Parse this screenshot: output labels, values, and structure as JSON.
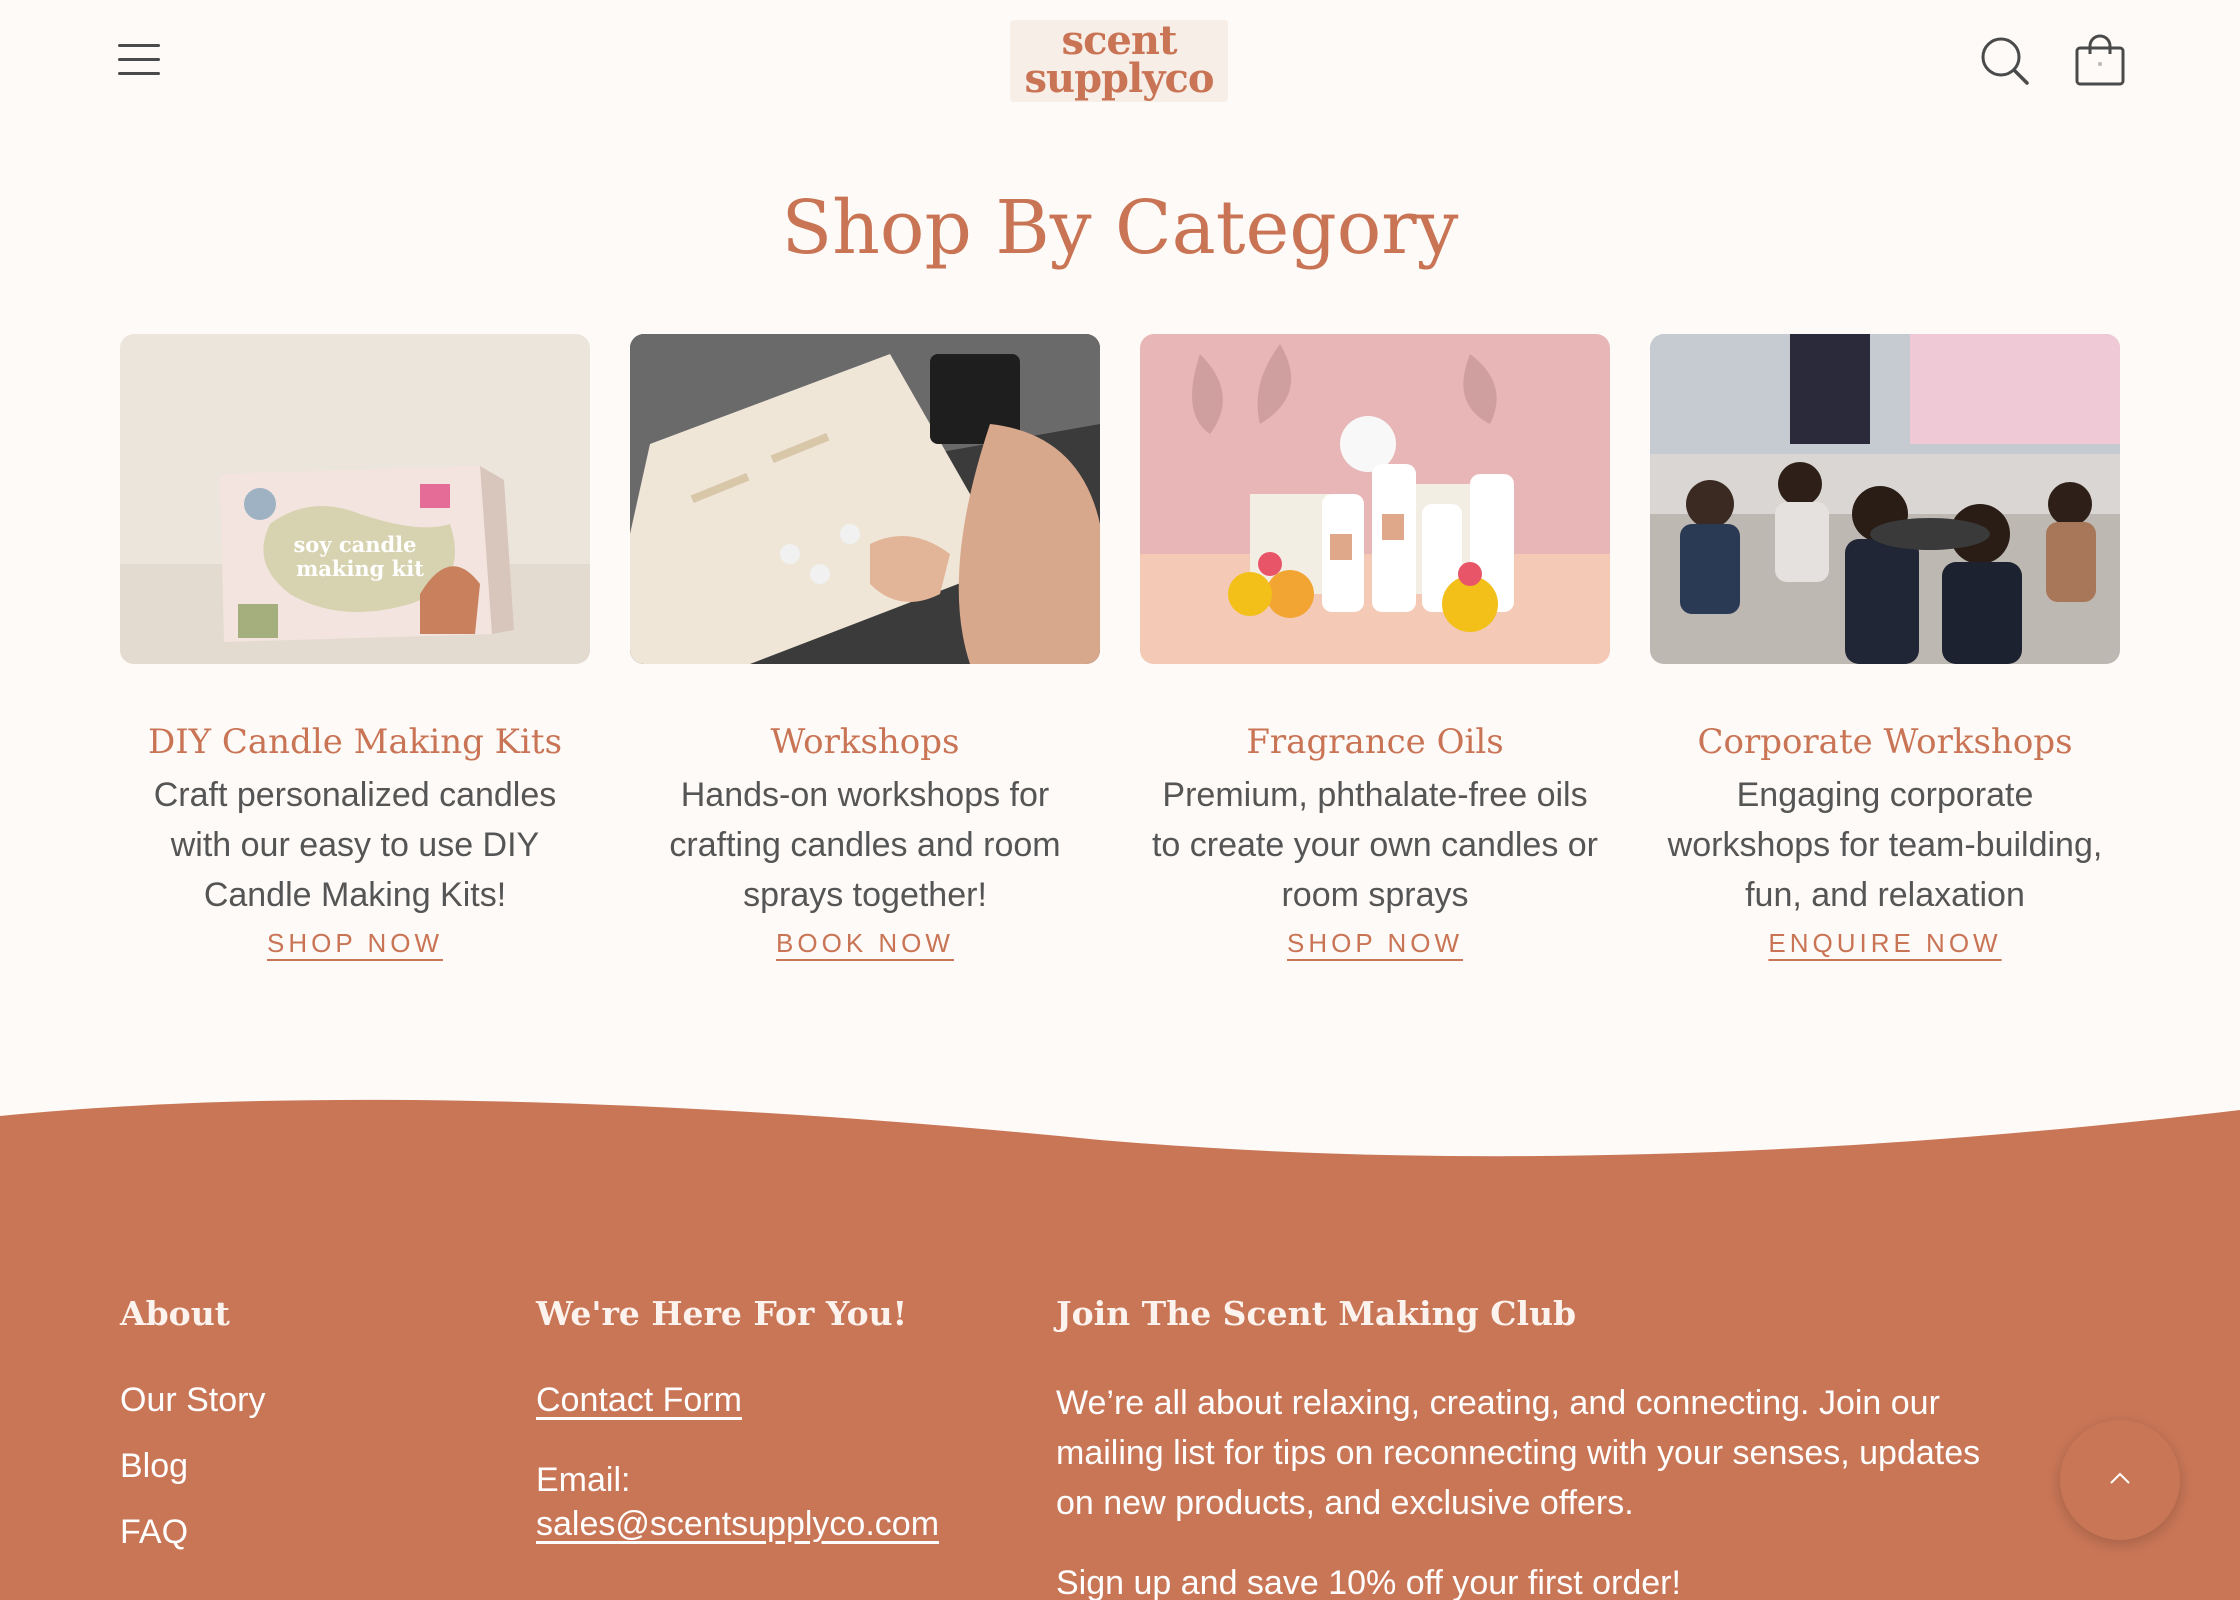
{
  "header": {
    "logo_line1": "scent",
    "logo_line2": "supplyco",
    "menu_icon": "hamburger-menu-icon",
    "search_icon": "search-icon",
    "cart_icon": "shopping-bag-icon"
  },
  "section": {
    "title": "Shop By Category"
  },
  "categories": [
    {
      "title": "DIY Candle Making Kits",
      "description": "Craft personalized candles with our easy to use DIY Candle Making Kits!",
      "cta": "SHOP NOW",
      "image_text_1": "soy candle",
      "image_text_2": "making kit"
    },
    {
      "title": "Workshops",
      "description": "Hands-on workshops for crafting candles and room sprays together!",
      "cta": "BOOK NOW"
    },
    {
      "title": "Fragrance Oils",
      "description": "Premium, phthalate-free oils to create your own candles or room sprays",
      "cta": "SHOP NOW"
    },
    {
      "title": "Corporate Workshops",
      "description": "Engaging corporate workshops for team-building, fun, and relaxation",
      "cta": "ENQUIRE NOW"
    }
  ],
  "footer": {
    "about": {
      "heading": "About",
      "links": [
        "Our Story",
        "Blog",
        "FAQ"
      ]
    },
    "help": {
      "heading": "We're Here For You!",
      "contact_link": "Contact Form",
      "email_label": "Email:",
      "email": "sales@scentsupplyco.com"
    },
    "club": {
      "heading": "Join The Scent Making Club",
      "text": "We’re all about relaxing, creating, and connecting. Join our mailing list for tips on reconnecting with your senses, updates on new products, and exclusive offers.",
      "offer": "Sign up and save 10% off your first order!"
    }
  },
  "back_to_top_icon": "chevron-up-icon",
  "colors": {
    "brand": "#c97455",
    "footer_bg": "#c97657",
    "page_bg": "#fdfaf7"
  }
}
